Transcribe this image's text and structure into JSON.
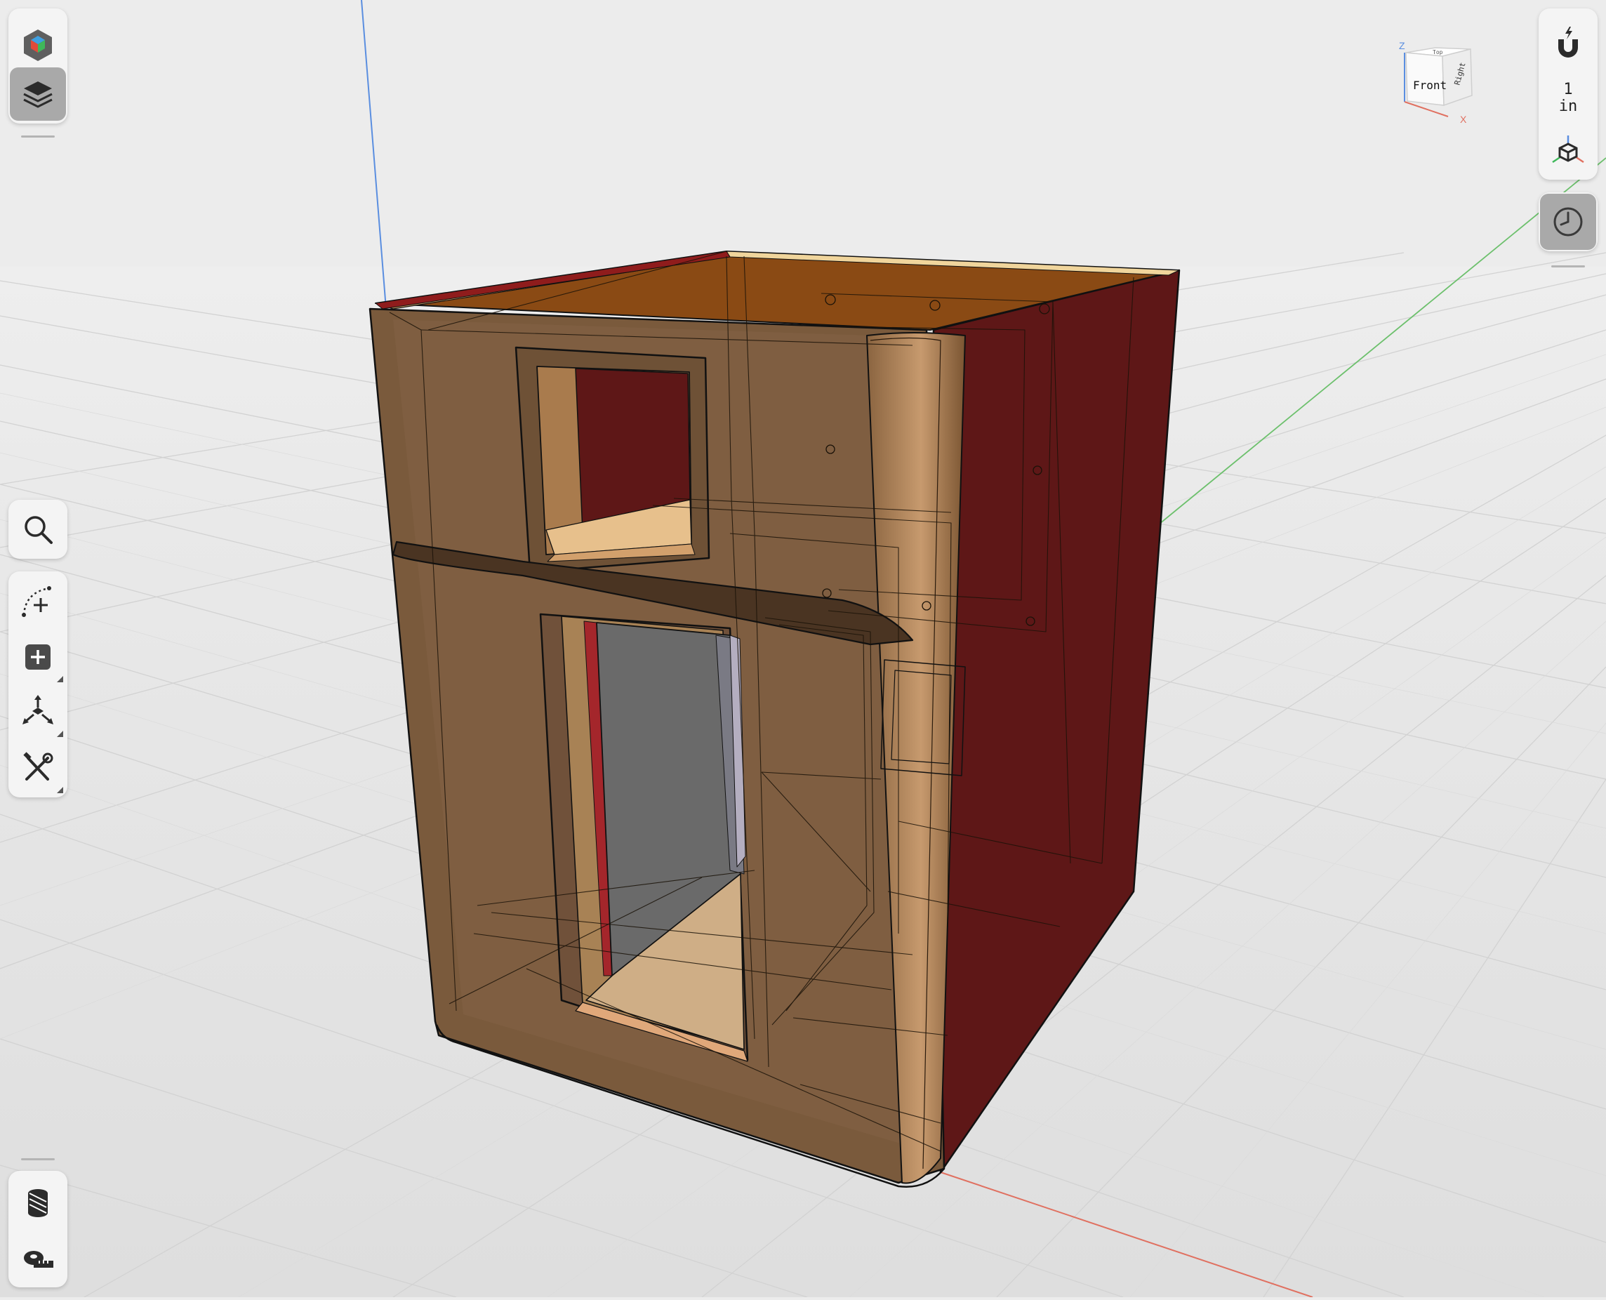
{
  "view_cube": {
    "front_label": "Front",
    "right_label": "Right",
    "top_label": "Top",
    "z_axis_label": "Z",
    "x_axis_label": "X"
  },
  "scale": {
    "value": "1",
    "unit": "in"
  },
  "left_toolbar": {
    "top_tools": [
      "object-icon",
      "layers-icon"
    ],
    "middle_tools": [
      "search-icon",
      "sketch-icon",
      "add-icon",
      "transform-icon",
      "tools-icon"
    ],
    "bottom_tools": [
      "section-icon",
      "measure-icon"
    ]
  },
  "right_toolbar": {
    "tools": [
      "snap-magnet-icon",
      "scale-readout",
      "view-orientation-icon",
      "history-clock-icon"
    ]
  },
  "colors": {
    "background": "#ececec",
    "cabinet_front": "#7a5a3c",
    "cabinet_side": "#5e1717",
    "cabinet_inner": "#cfae86",
    "glass_panel": "#6a6a6a",
    "x_axis": "#e07060",
    "y_axis": "#6cc06c",
    "z_axis": "#5a8ee0"
  }
}
